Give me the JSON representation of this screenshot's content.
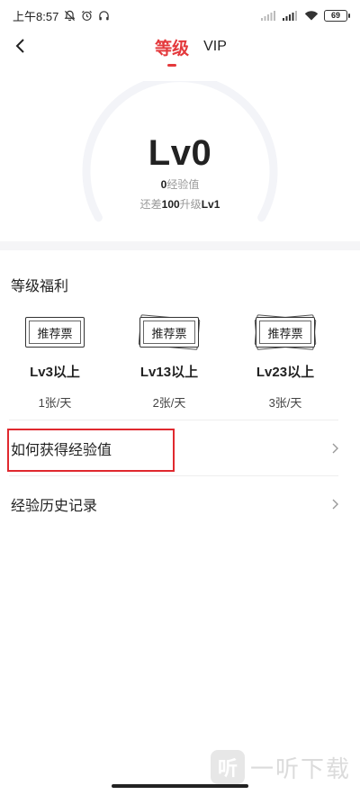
{
  "status_bar": {
    "time": "上午8:57",
    "battery": "69"
  },
  "nav": {
    "tab_level": "等级",
    "tab_vip": "VIP"
  },
  "colors": {
    "accent": "#e4393c",
    "progress_dot": "#f0604a",
    "gauge_track": "#f3f4f8"
  },
  "level": {
    "name": "Lv0",
    "exp_value": "0",
    "exp_label": "经验值",
    "next_prefix": "还差",
    "next_value": "100",
    "next_mid": "升级",
    "next_level": "Lv1",
    "progress_fraction": 0
  },
  "benefits": {
    "title": "等级福利",
    "items": [
      {
        "ticket_text": "推荐票",
        "level": "Lv3以上",
        "amount": "1张/天",
        "stack": 1
      },
      {
        "ticket_text": "推荐票",
        "level": "Lv13以上",
        "amount": "2张/天",
        "stack": 2
      },
      {
        "ticket_text": "推荐票",
        "level": "Lv23以上",
        "amount": "3张/天",
        "stack": 3
      }
    ]
  },
  "list": {
    "how_to_get_exp": "如何获得经验值",
    "exp_history": "经验历史记录"
  },
  "watermark": {
    "logo_char": "听",
    "text": "一听下载"
  }
}
